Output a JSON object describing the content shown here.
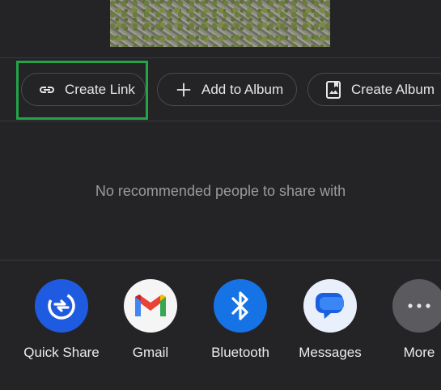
{
  "actions": {
    "create_link": "Create Link",
    "add_to_album": "Add to Album",
    "create_album": "Create Album"
  },
  "empty_state": "No recommended people to share with",
  "apps": [
    {
      "label": "Quick Share",
      "icon": "quick-share-icon",
      "color": "#1f5be0"
    },
    {
      "label": "Gmail",
      "icon": "gmail-icon",
      "color": "#f5f5f5"
    },
    {
      "label": "Bluetooth",
      "icon": "bluetooth-icon",
      "color": "#1673e6"
    },
    {
      "label": "Messages",
      "icon": "messages-icon",
      "color": "#eaf0fb"
    },
    {
      "label": "More",
      "icon": "more-icon",
      "color": "#5b5b5f"
    }
  ],
  "colors": {
    "background": "#242427",
    "highlight": "#22a447",
    "text": "#e6e6e6",
    "muted_text": "#9a9aa0"
  }
}
